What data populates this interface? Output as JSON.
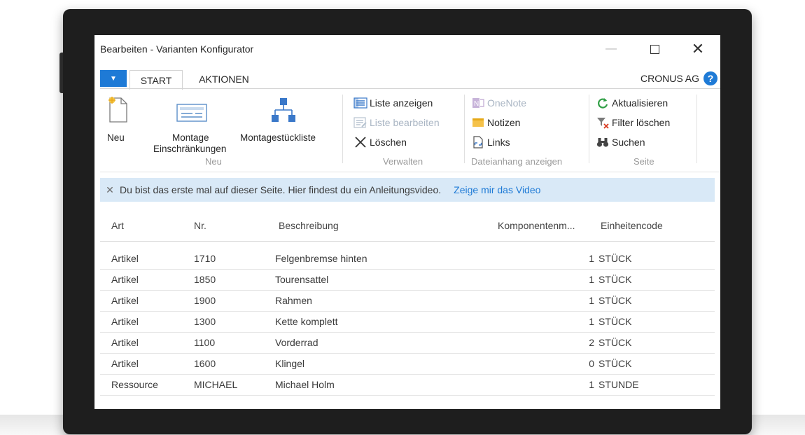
{
  "window": {
    "title": "Bearbeiten - Varianten Konfigurator",
    "minimize_glyph": "—",
    "close_glyph": "✕"
  },
  "tabs": {
    "menu_glyph": "▼",
    "items": [
      {
        "label": "START",
        "active": true
      },
      {
        "label": "AKTIONEN",
        "active": false
      }
    ],
    "company": "CRONUS AG",
    "help_glyph": "?"
  },
  "ribbon": {
    "groups": {
      "neu": {
        "label": "Neu",
        "buttons": [
          {
            "label": "Neu",
            "icon": "new-document-icon"
          },
          {
            "label_line1": "Montage",
            "label_line2": "Einschränkungen",
            "icon": "assembly-constraints-icon"
          },
          {
            "label": "Montagestückliste",
            "icon": "hierarchy-icon"
          }
        ]
      },
      "verwalten": {
        "label": "Verwalten",
        "buttons": [
          {
            "label": "Liste anzeigen",
            "icon": "list-view-icon",
            "enabled": true
          },
          {
            "label": "Liste bearbeiten",
            "icon": "list-edit-icon",
            "enabled": false
          },
          {
            "label": "Löschen",
            "icon": "delete-x-icon",
            "enabled": true
          }
        ]
      },
      "dateianhang": {
        "label": "Dateianhang anzeigen",
        "buttons": [
          {
            "label": "OneNote",
            "icon": "onenote-icon",
            "enabled": false
          },
          {
            "label": "Notizen",
            "icon": "notes-icon",
            "enabled": true
          },
          {
            "label": "Links",
            "icon": "links-icon",
            "enabled": true
          }
        ]
      },
      "seite": {
        "label": "Seite",
        "buttons": [
          {
            "label": "Aktualisieren",
            "icon": "refresh-icon",
            "enabled": true
          },
          {
            "label": "Filter löschen",
            "icon": "clear-filter-icon",
            "enabled": true
          },
          {
            "label": "Suchen",
            "icon": "binoculars-icon",
            "enabled": true
          }
        ]
      }
    }
  },
  "notification": {
    "close_glyph": "✕",
    "text": "Du bist das erste mal auf dieser Seite. Hier findest du ein Anleitungsvideo.",
    "link": "Zeige mir das Video"
  },
  "table": {
    "columns": [
      "Art",
      "Nr.",
      "Beschreibung",
      "Komponentenm...",
      "Einheitencode"
    ],
    "rows": [
      {
        "art": "Artikel",
        "nr": "1710",
        "beschreibung": "Felgenbremse hinten",
        "menge": "1",
        "einheit": "STÜCK"
      },
      {
        "art": "Artikel",
        "nr": "1850",
        "beschreibung": "Tourensattel",
        "menge": "1",
        "einheit": "STÜCK"
      },
      {
        "art": "Artikel",
        "nr": "1900",
        "beschreibung": "Rahmen",
        "menge": "1",
        "einheit": "STÜCK"
      },
      {
        "art": "Artikel",
        "nr": "1300",
        "beschreibung": "Kette komplett",
        "menge": "1",
        "einheit": "STÜCK"
      },
      {
        "art": "Artikel",
        "nr": "1100",
        "beschreibung": "Vorderrad",
        "menge": "2",
        "einheit": "STÜCK"
      },
      {
        "art": "Artikel",
        "nr": "1600",
        "beschreibung": "Klingel",
        "menge": "0",
        "einheit": "STÜCK"
      },
      {
        "art": "Ressource",
        "nr": "MICHAEL",
        "beschreibung": "Michael Holm",
        "menge": "1",
        "einheit": "STUNDE"
      }
    ]
  },
  "colors": {
    "accent": "#1e7ad6",
    "notification_bg": "#d9e9f7",
    "disabled_text": "#a9b5c3",
    "tablet_bezel": "#1e1e1e"
  }
}
